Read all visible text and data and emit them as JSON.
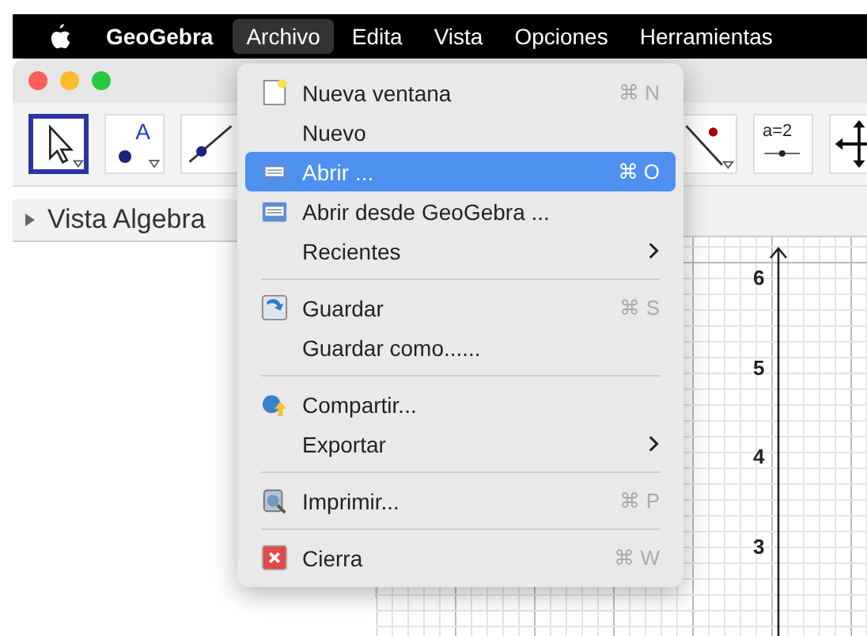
{
  "menu_bar": {
    "app": "GeoGebra",
    "items": [
      {
        "label": "Archivo",
        "selected": true
      },
      {
        "label": "Edita",
        "selected": false
      },
      {
        "label": "Vista",
        "selected": false
      },
      {
        "label": "Opciones",
        "selected": false
      },
      {
        "label": "Herramientas",
        "selected": false
      }
    ]
  },
  "toolbar": {
    "tools": [
      {
        "kind": "select",
        "selected": true
      },
      {
        "kind": "point",
        "label": "A",
        "selected": false
      },
      {
        "kind": "line",
        "selected": false
      },
      {
        "kind": "perpendicular",
        "selected": false
      },
      {
        "kind": "slider",
        "label": "a=2",
        "selected": false
      },
      {
        "kind": "move",
        "selected": false
      }
    ]
  },
  "algebra_view": {
    "title": "Vista Algebra"
  },
  "graphics_view": {
    "y_labels": [
      "6",
      "5",
      "4",
      "3"
    ]
  },
  "file_menu": {
    "items": [
      {
        "kind": "item",
        "label": "Nueva ventana",
        "shortcut": "⌘ N",
        "selected": false
      },
      {
        "kind": "item",
        "label": "Nuevo",
        "selected": false
      },
      {
        "kind": "item",
        "label": "Abrir ...",
        "shortcut": "⌘ O",
        "selected": true
      },
      {
        "kind": "item",
        "label": "Abrir desde GeoGebra ...",
        "selected": false
      },
      {
        "kind": "item",
        "label": "Recientes",
        "submenu": true,
        "selected": false
      },
      {
        "kind": "separator"
      },
      {
        "kind": "item",
        "label": "Guardar",
        "shortcut": "⌘ S",
        "selected": false
      },
      {
        "kind": "item",
        "label": "Guardar como......",
        "selected": false
      },
      {
        "kind": "separator"
      },
      {
        "kind": "item",
        "label": "Compartir...",
        "selected": false
      },
      {
        "kind": "item",
        "label": "Exportar",
        "submenu": true,
        "selected": false
      },
      {
        "kind": "separator"
      },
      {
        "kind": "item",
        "label": "Imprimir...",
        "shortcut": "⌘ P",
        "selected": false
      },
      {
        "kind": "separator"
      },
      {
        "kind": "item",
        "label": "Cierra",
        "shortcut": "⌘ W",
        "selected": false
      }
    ]
  }
}
